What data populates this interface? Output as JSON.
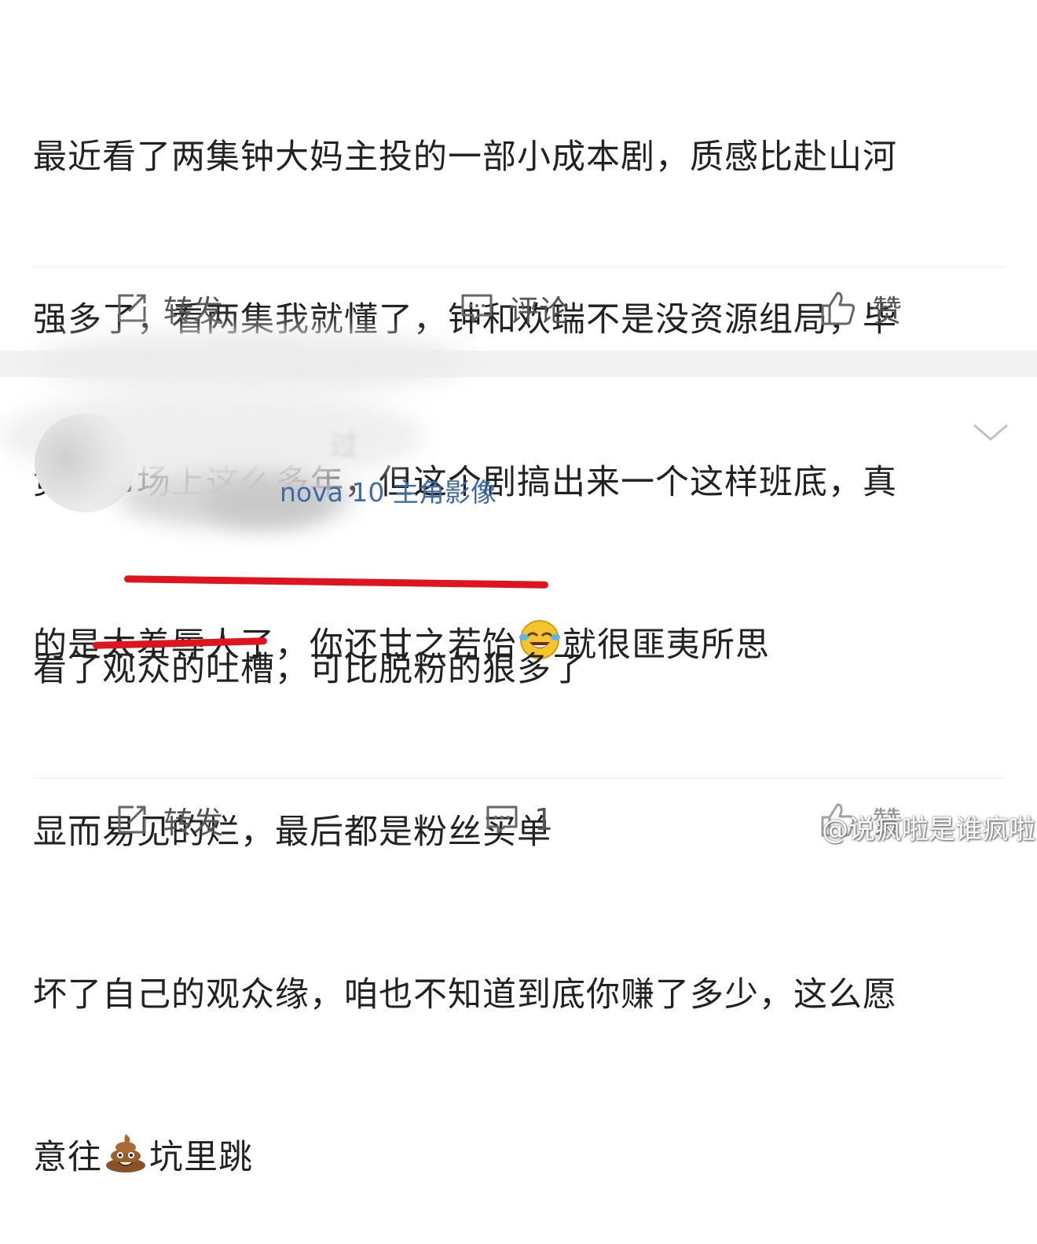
{
  "post": {
    "lines": [
      "最近看了两集钟大妈主投的一部小成本剧，质感比赴山河",
      "强多了，看两集我就懂了，钟和欢瑞不是没资源组局，毕",
      "竟在市场上这么多年，但这个剧搞出来一个这样班底，真",
      "的是太羞辱人了，你还甘之若饴"
    ],
    "line4_tail": "就很匪夷所思",
    "emoji_name": "laughing-crying-emoji"
  },
  "post_actions": {
    "repost": "转发",
    "comment": "评论",
    "like": "赞"
  },
  "comment": {
    "username": "过",
    "device": "nova 10 主角影像",
    "lines": [
      "看了观众的吐槽，可比脱粉的狠多了",
      "显而易见的烂，最后都是粉丝买单",
      "坏了自己的观众缘，咱也不知道到底你赚了多少，这么愿"
    ],
    "line4_head": "意往",
    "line4_tail": "坑里跳",
    "emoji_name": "poop-emoji"
  },
  "comment_actions": {
    "repost": "转发",
    "comment_count": "1",
    "like": "赞"
  },
  "watermark": "@说疯啦是谁疯啦",
  "colors": {
    "underline": "#e0141e",
    "link": "#3e6ca8",
    "band": "#f2f2f2"
  }
}
